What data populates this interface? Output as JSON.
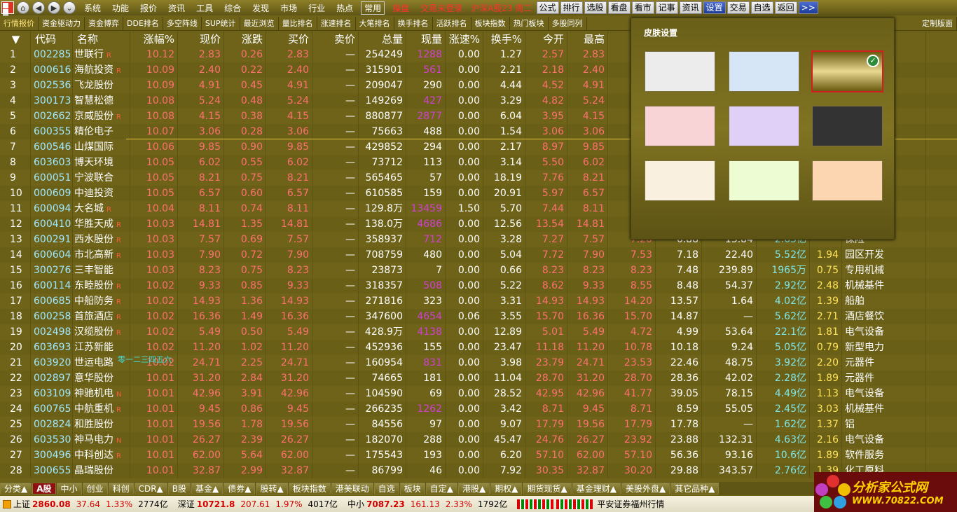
{
  "menubar": {
    "nav": [
      "⌂",
      "◀",
      "▶",
      "⌄"
    ],
    "items": [
      "系统",
      "功能",
      "报价",
      "资讯",
      "工具",
      "综合",
      "发现",
      "市场",
      "行业",
      "热点"
    ],
    "boxed": "常用",
    "red1": "操盘",
    "trade_status": "交易未登录",
    "index_info": "沪深A股23 周二",
    "right_buttons": [
      "公式",
      "排行",
      "选股",
      "看盘",
      "看市",
      "记事",
      "资讯",
      "设置",
      "交易",
      "自选",
      "返回",
      ">>"
    ]
  },
  "tabs": [
    "行情报价",
    "资金驱动力",
    "资金博弈",
    "DDE排名",
    "多空阵线",
    "SUP统计",
    "最近浏览",
    "量比排名",
    "涨速排名",
    "大笔排名",
    "换手排名",
    "活跃排名",
    "板块指数",
    "热门板块",
    "多股同列",
    "",
    "",
    "",
    "",
    "",
    "定制版面"
  ],
  "columns": [
    "▼",
    "代码",
    "名称",
    "涨幅%",
    "现价",
    "涨跌",
    "买价",
    "卖价",
    "总量",
    "现量",
    "涨速%",
    "换手%",
    "今开",
    "最高",
    "最低",
    "昨收",
    "市盈",
    "总市值",
    "量比",
    "细分行业"
  ],
  "rows": [
    {
      "i": "1",
      "code": "002285",
      "name": "世联行",
      "flag": "R",
      "chg": "10.12",
      "price": "2.83",
      "diff": "0.26",
      "bid": "2.83",
      "ask": "—",
      "vol": "254249",
      "cur": "1288",
      "speed": "0.00",
      "turn": "1.27",
      "open": "2.57",
      "high": "2.83",
      "low": "",
      "prev": "",
      "pe": "",
      "cap": "",
      "ratio": "",
      "ind": "务"
    },
    {
      "i": "2",
      "code": "000616",
      "name": "海航投资",
      "flag": "R",
      "chg": "10.09",
      "price": "2.40",
      "diff": "0.22",
      "bid": "2.40",
      "ask": "—",
      "vol": "315901",
      "cur": "561",
      "speed": "0.00",
      "turn": "2.21",
      "open": "2.18",
      "high": "2.40",
      "low": "",
      "prev": "",
      "pe": "",
      "cap": "",
      "ratio": "",
      "ind": "资"
    },
    {
      "i": "3",
      "code": "002536",
      "name": "飞龙股份",
      "flag": "",
      "chg": "10.09",
      "price": "4.91",
      "diff": "0.45",
      "bid": "4.91",
      "ask": "—",
      "vol": "209047",
      "cur": "290",
      "speed": "0.00",
      "turn": "4.44",
      "open": "4.52",
      "high": "4.91",
      "low": "",
      "prev": "",
      "pe": "",
      "cap": "",
      "ratio": "",
      "ind": "件"
    },
    {
      "i": "4",
      "code": "300173",
      "name": "智慧松德",
      "flag": "",
      "chg": "10.08",
      "price": "5.24",
      "diff": "0.48",
      "bid": "5.24",
      "ask": "—",
      "vol": "149269",
      "cur": "427",
      "speed": "0.00",
      "turn": "3.29",
      "open": "4.82",
      "high": "5.24",
      "low": "",
      "prev": "",
      "pe": "",
      "cap": "",
      "ratio": "",
      "ind": "械"
    },
    {
      "i": "5",
      "code": "002662",
      "name": "京威股份",
      "flag": "R",
      "chg": "10.08",
      "price": "4.15",
      "diff": "0.38",
      "bid": "4.15",
      "ask": "—",
      "vol": "880877",
      "cur": "2877",
      "speed": "0.00",
      "turn": "6.04",
      "open": "3.95",
      "high": "4.15",
      "low": "",
      "prev": "",
      "pe": "",
      "cap": "",
      "ratio": "",
      "ind": "件"
    },
    {
      "i": "6",
      "code": "600355",
      "name": "精伦电子",
      "flag": "",
      "chg": "10.07",
      "price": "3.06",
      "diff": "0.28",
      "bid": "3.06",
      "ask": "—",
      "vol": "75663",
      "cur": "488",
      "speed": "0.00",
      "turn": "1.54",
      "open": "3.06",
      "high": "3.06",
      "low": "",
      "prev": "",
      "pe": "",
      "cap": "",
      "ratio": "",
      "ind": ""
    },
    {
      "i": "7",
      "code": "600546",
      "name": "山煤国际",
      "flag": "",
      "chg": "10.06",
      "price": "9.85",
      "diff": "0.90",
      "bid": "9.85",
      "ask": "—",
      "vol": "429852",
      "cur": "294",
      "speed": "0.00",
      "turn": "2.17",
      "open": "8.97",
      "high": "9.85",
      "low": "",
      "prev": "",
      "pe": "",
      "cap": "",
      "ratio": "",
      "ind": "采"
    },
    {
      "i": "8",
      "code": "603603",
      "name": "博天环境",
      "flag": "",
      "chg": "10.05",
      "price": "6.02",
      "diff": "0.55",
      "bid": "6.02",
      "ask": "—",
      "vol": "73712",
      "cur": "113",
      "speed": "0.00",
      "turn": "3.14",
      "open": "5.50",
      "high": "6.02",
      "low": "",
      "prev": "",
      "pe": "",
      "cap": "",
      "ratio": "",
      "ind": "护"
    },
    {
      "i": "9",
      "code": "600051",
      "name": "宁波联合",
      "flag": "",
      "chg": "10.05",
      "price": "8.21",
      "diff": "0.75",
      "bid": "8.21",
      "ask": "—",
      "vol": "565465",
      "cur": "57",
      "speed": "0.00",
      "turn": "18.19",
      "open": "7.76",
      "high": "8.21",
      "low": "",
      "prev": "",
      "pe": "",
      "cap": "",
      "ratio": "",
      "ind": ""
    },
    {
      "i": "10",
      "code": "000609",
      "name": "中迪投资",
      "flag": "",
      "chg": "10.05",
      "price": "6.57",
      "diff": "0.60",
      "bid": "6.57",
      "ask": "—",
      "vol": "610585",
      "cur": "159",
      "speed": "0.00",
      "turn": "20.91",
      "open": "5.97",
      "high": "6.57",
      "low": "",
      "prev": "",
      "pe": "",
      "cap": "",
      "ratio": "",
      "ind": ""
    },
    {
      "i": "11",
      "code": "600094",
      "name": "大名城",
      "flag": "R",
      "chg": "10.04",
      "price": "8.11",
      "diff": "0.74",
      "bid": "8.11",
      "ask": "—",
      "vol": "129.8万",
      "cur": "13459",
      "speed": "1.50",
      "turn": "5.70",
      "open": "7.44",
      "high": "8.11",
      "low": "",
      "prev": "",
      "pe": "",
      "cap": "",
      "ratio": "",
      "ind": ""
    },
    {
      "i": "12",
      "code": "600410",
      "name": "华胜天成",
      "flag": "R",
      "chg": "10.03",
      "price": "14.81",
      "diff": "1.35",
      "bid": "14.81",
      "ask": "—",
      "vol": "138.0万",
      "cur": "4686",
      "speed": "0.00",
      "turn": "12.56",
      "open": "13.54",
      "high": "14.81",
      "low": "",
      "prev": "",
      "pe": "",
      "cap": "",
      "ratio": "",
      "ind": "务"
    },
    {
      "i": "13",
      "code": "600291",
      "name": "西水股份",
      "flag": "R",
      "chg": "10.03",
      "price": "7.57",
      "diff": "0.69",
      "bid": "7.57",
      "ask": "—",
      "vol": "358937",
      "cur": "712",
      "speed": "0.00",
      "turn": "3.28",
      "open": "7.27",
      "high": "7.57",
      "low": "7.20",
      "prev": "6.88",
      "pe": "13.84",
      "cap": "2.65亿",
      "ratio": "",
      "ind": "保险"
    },
    {
      "i": "14",
      "code": "600604",
      "name": "市北高新",
      "flag": "R",
      "chg": "10.03",
      "price": "7.90",
      "diff": "0.72",
      "bid": "7.90",
      "ask": "—",
      "vol": "708759",
      "cur": "480",
      "speed": "0.00",
      "turn": "5.04",
      "open": "7.72",
      "high": "7.90",
      "low": "7.53",
      "prev": "7.18",
      "pe": "22.40",
      "cap": "5.52亿",
      "ratio": "1.94",
      "ind": "园区开发"
    },
    {
      "i": "15",
      "code": "300276",
      "name": "三丰智能",
      "flag": "",
      "chg": "10.03",
      "price": "8.23",
      "diff": "0.75",
      "bid": "8.23",
      "ask": "—",
      "vol": "23873",
      "cur": "7",
      "speed": "0.00",
      "turn": "0.66",
      "open": "8.23",
      "high": "8.23",
      "low": "8.23",
      "prev": "7.48",
      "pe": "239.89",
      "cap": "1965万",
      "ratio": "0.75",
      "ind": "专用机械"
    },
    {
      "i": "16",
      "code": "600114",
      "name": "东睦股份",
      "flag": "R",
      "chg": "10.02",
      "price": "9.33",
      "diff": "0.85",
      "bid": "9.33",
      "ask": "—",
      "vol": "318357",
      "cur": "508",
      "speed": "0.00",
      "turn": "5.22",
      "open": "8.62",
      "high": "9.33",
      "low": "8.55",
      "prev": "8.48",
      "pe": "54.37",
      "cap": "2.92亿",
      "ratio": "2.48",
      "ind": "机械基件"
    },
    {
      "i": "17",
      "code": "600685",
      "name": "中船防务",
      "flag": "R",
      "chg": "10.02",
      "price": "14.93",
      "diff": "1.36",
      "bid": "14.93",
      "ask": "—",
      "vol": "271816",
      "cur": "323",
      "speed": "0.00",
      "turn": "3.31",
      "open": "14.93",
      "high": "14.93",
      "low": "14.20",
      "prev": "13.57",
      "pe": "1.64",
      "cap": "4.02亿",
      "ratio": "1.39",
      "ind": "船舶"
    },
    {
      "i": "18",
      "code": "600258",
      "name": "首旅酒店",
      "flag": "R",
      "chg": "10.02",
      "price": "16.36",
      "diff": "1.49",
      "bid": "16.36",
      "ask": "—",
      "vol": "347600",
      "cur": "4654",
      "speed": "0.06",
      "turn": "3.55",
      "open": "15.70",
      "high": "16.36",
      "low": "15.70",
      "prev": "14.87",
      "pe": "—",
      "cap": "5.62亿",
      "ratio": "2.71",
      "ind": "酒店餐饮"
    },
    {
      "i": "19",
      "code": "002498",
      "name": "汉缆股份",
      "flag": "R",
      "chg": "10.02",
      "price": "5.49",
      "diff": "0.50",
      "bid": "5.49",
      "ask": "—",
      "vol": "428.9万",
      "cur": "4138",
      "speed": "0.00",
      "turn": "12.89",
      "open": "5.01",
      "high": "5.49",
      "low": "4.72",
      "prev": "4.99",
      "pe": "53.64",
      "cap": "22.1亿",
      "ratio": "1.81",
      "ind": "电气设备"
    },
    {
      "i": "20",
      "code": "603693",
      "name": "江苏新能",
      "flag": "",
      "chg": "10.02",
      "price": "11.20",
      "diff": "1.02",
      "bid": "11.20",
      "ask": "—",
      "vol": "452936",
      "cur": "155",
      "speed": "0.00",
      "turn": "23.47",
      "open": "11.18",
      "high": "11.20",
      "low": "10.78",
      "prev": "10.18",
      "pe": "9.24",
      "cap": "5.05亿",
      "ratio": "0.79",
      "ind": "新型电力"
    },
    {
      "i": "21",
      "code": "603920",
      "name": "世运电路",
      "flag": "",
      "chg": "10.02",
      "price": "24.71",
      "diff": "2.25",
      "bid": "24.71",
      "ask": "—",
      "vol": "160954",
      "cur": "831",
      "speed": "0.00",
      "turn": "3.98",
      "open": "23.79",
      "high": "24.71",
      "low": "23.53",
      "prev": "22.46",
      "pe": "48.75",
      "cap": "3.92亿",
      "ratio": "2.20",
      "ind": "元器件"
    },
    {
      "i": "22",
      "code": "002897",
      "name": "意华股份",
      "flag": "",
      "chg": "10.01",
      "price": "31.20",
      "diff": "2.84",
      "bid": "31.20",
      "ask": "—",
      "vol": "74665",
      "cur": "181",
      "speed": "0.00",
      "turn": "11.04",
      "open": "28.70",
      "high": "31.20",
      "low": "28.70",
      "prev": "28.36",
      "pe": "42.02",
      "cap": "2.28亿",
      "ratio": "1.89",
      "ind": "元器件"
    },
    {
      "i": "23",
      "code": "603109",
      "name": "神驰机电",
      "flag": "N",
      "chg": "10.01",
      "price": "42.96",
      "diff": "3.91",
      "bid": "42.96",
      "ask": "—",
      "vol": "104590",
      "cur": "69",
      "speed": "0.00",
      "turn": "28.52",
      "open": "42.95",
      "high": "42.96",
      "low": "41.77",
      "prev": "39.05",
      "pe": "78.15",
      "cap": "4.49亿",
      "ratio": "1.13",
      "ind": "电气设备"
    },
    {
      "i": "24",
      "code": "600765",
      "name": "中航重机",
      "flag": "R",
      "chg": "10.01",
      "price": "9.45",
      "diff": "0.86",
      "bid": "9.45",
      "ask": "—",
      "vol": "266235",
      "cur": "1262",
      "speed": "0.00",
      "turn": "3.42",
      "open": "8.71",
      "high": "9.45",
      "low": "8.71",
      "prev": "8.59",
      "pe": "55.05",
      "cap": "2.45亿",
      "ratio": "3.03",
      "ind": "机械基件"
    },
    {
      "i": "25",
      "code": "002824",
      "name": "和胜股份",
      "flag": "",
      "chg": "10.01",
      "price": "19.56",
      "diff": "1.78",
      "bid": "19.56",
      "ask": "—",
      "vol": "84556",
      "cur": "97",
      "speed": "0.00",
      "turn": "9.07",
      "open": "17.79",
      "high": "19.56",
      "low": "17.79",
      "prev": "17.78",
      "pe": "—",
      "cap": "1.62亿",
      "ratio": "1.37",
      "ind": "铝"
    },
    {
      "i": "26",
      "code": "603530",
      "name": "神马电力",
      "flag": "N",
      "chg": "10.01",
      "price": "26.27",
      "diff": "2.39",
      "bid": "26.27",
      "ask": "—",
      "vol": "182070",
      "cur": "288",
      "speed": "0.00",
      "turn": "45.47",
      "open": "24.76",
      "high": "26.27",
      "low": "23.92",
      "prev": "23.88",
      "pe": "132.31",
      "cap": "4.63亿",
      "ratio": "2.16",
      "ind": "电气设备"
    },
    {
      "i": "27",
      "code": "300496",
      "name": "中科创达",
      "flag": "R",
      "chg": "10.01",
      "price": "62.00",
      "diff": "5.64",
      "bid": "62.00",
      "ask": "—",
      "vol": "175543",
      "cur": "193",
      "speed": "0.00",
      "turn": "6.20",
      "open": "57.10",
      "high": "62.00",
      "low": "57.10",
      "prev": "56.36",
      "pe": "93.16",
      "cap": "10.6亿",
      "ratio": "1.89",
      "ind": "软件服务"
    },
    {
      "i": "28",
      "code": "300655",
      "name": "晶瑞股份",
      "flag": "",
      "chg": "10.01",
      "price": "32.87",
      "diff": "2.99",
      "bid": "32.87",
      "ask": "—",
      "vol": "86799",
      "cur": "46",
      "speed": "0.00",
      "turn": "7.92",
      "open": "30.35",
      "high": "32.87",
      "low": "30.20",
      "prev": "29.88",
      "pe": "343.57",
      "cap": "2.76亿",
      "ratio": "1.39",
      "ind": "化工原料"
    }
  ],
  "bottom_tabs": [
    "分类▲",
    "A股",
    "中小",
    "创业",
    "科创",
    "CDR▲",
    "B股",
    "基金▲",
    "债券▲",
    "股转▲",
    "板块指数",
    "港美联动",
    "自选",
    "板块",
    "自定▲",
    "港股▲",
    "期权▲",
    "期货现货▲",
    "基金理财▲",
    "美股外盘▲",
    "其它品种▲"
  ],
  "status": {
    "sh_label": "上证",
    "sh_val": "2860.08",
    "sh_chg": "37.64",
    "sh_pct": "1.33%",
    "sh_amt": "2774亿",
    "sz_label": "深证",
    "sz_val": "10721.8",
    "sz_chg": "207.61",
    "sz_pct": "1.97%",
    "sz_amt": "4017亿",
    "zx_label": "中小",
    "zx_val": "7087.23",
    "zx_chg": "161.13",
    "zx_pct": "2.33%",
    "zx_amt": "1792亿",
    "broker": "平安证券福州行情"
  },
  "skin": {
    "title": "皮肤设置",
    "colors": [
      "#ececec",
      "#d6e6f6",
      "#b09a3a",
      "#f9d4d6",
      "#e0d0f8",
      "#333333",
      "#faf0e0",
      "#eefcd4",
      "#fbd6b0"
    ],
    "selected_index": 2
  },
  "hint": "零一二三四五六",
  "brand": {
    "title": "分析家公式网",
    "url": "WWW.70822.COM"
  }
}
